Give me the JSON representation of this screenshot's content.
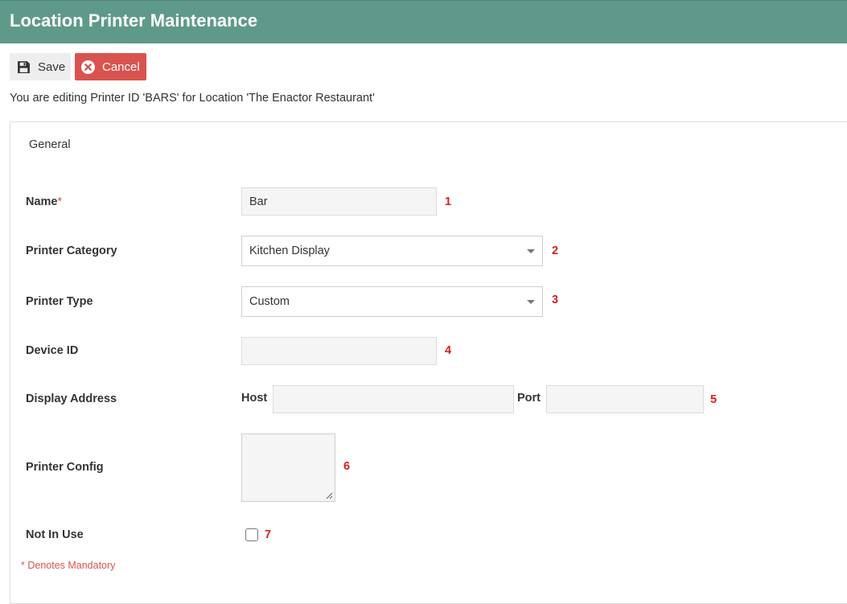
{
  "header": {
    "title": "Location Printer Maintenance"
  },
  "toolbar": {
    "save_label": "Save",
    "save_icon": "floppy-disk-icon",
    "cancel_label": "Cancel",
    "cancel_icon": "close-circle-icon",
    "cancel_color": "#d9534f"
  },
  "info": {
    "text": "You are editing Printer ID 'BARS' for Location 'The Enactor Restaurant'"
  },
  "tabs": {
    "general": "General"
  },
  "form": {
    "name": {
      "label": "Name",
      "required_mark": "*",
      "value": "Bar",
      "marker": "1"
    },
    "printer_category": {
      "label": "Printer Category",
      "value": "Kitchen Display",
      "marker": "2"
    },
    "printer_type": {
      "label": "Printer Type",
      "value": "Custom",
      "marker": "3"
    },
    "device_id": {
      "label": "Device ID",
      "value": "",
      "marker": "4"
    },
    "display_address": {
      "label": "Display Address",
      "host_label": "Host",
      "host_value": "",
      "port_label": "Port",
      "port_value": "",
      "marker": "5"
    },
    "printer_config": {
      "label": "Printer Config",
      "value": "",
      "marker": "6"
    },
    "not_in_use": {
      "label": "Not In Use",
      "checked": false,
      "marker": "7"
    }
  },
  "footer": {
    "mandatory_note": "* Denotes Mandatory"
  },
  "colors": {
    "header_bg": "#5f998a",
    "marker": "#d42020",
    "accent_red": "#d9534f"
  }
}
